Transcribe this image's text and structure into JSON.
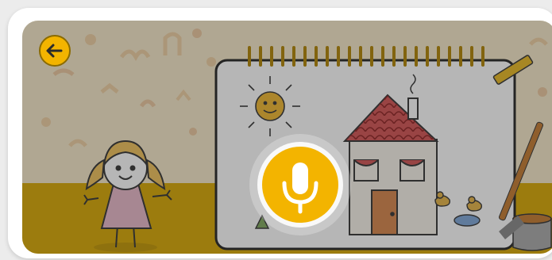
{
  "screen": {
    "name": "drawing-story-voice-screen"
  },
  "navigation": {
    "back_icon": "arrow-left-icon"
  },
  "voice": {
    "mic_icon": "microphone-icon",
    "state": "listening"
  },
  "colors": {
    "accent": "#f3b400",
    "background": "#f6e9c9",
    "floor": "#d8a800",
    "overlay": "#333333"
  }
}
